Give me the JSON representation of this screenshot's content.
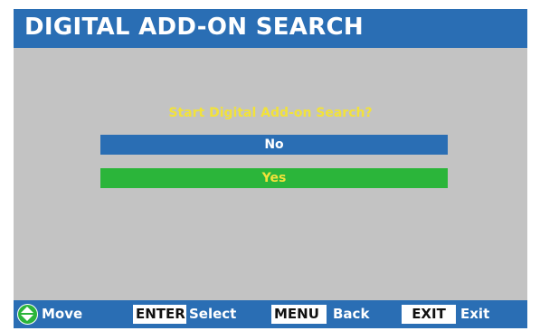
{
  "header": {
    "title": "DIGITAL ADD-ON SEARCH"
  },
  "dialog": {
    "prompt": "Start Digital Add-on Search?",
    "options": [
      {
        "label": "No",
        "highlighted": false
      },
      {
        "label": "Yes",
        "highlighted": true
      }
    ]
  },
  "footer": {
    "move_label": "Move",
    "enter_key": "ENTER",
    "enter_label": "Select",
    "menu_key": "MENU",
    "menu_label": "Back",
    "exit_key": "EXIT",
    "exit_label": "Exit"
  },
  "colors": {
    "screen_bg": "#c3c3c3",
    "bar_blue": "#2a6eb4",
    "selected_green": "#2bb53a",
    "prompt_yellow": "#f2e23a"
  },
  "icons": {
    "move": "up-down-arrows-icon"
  }
}
